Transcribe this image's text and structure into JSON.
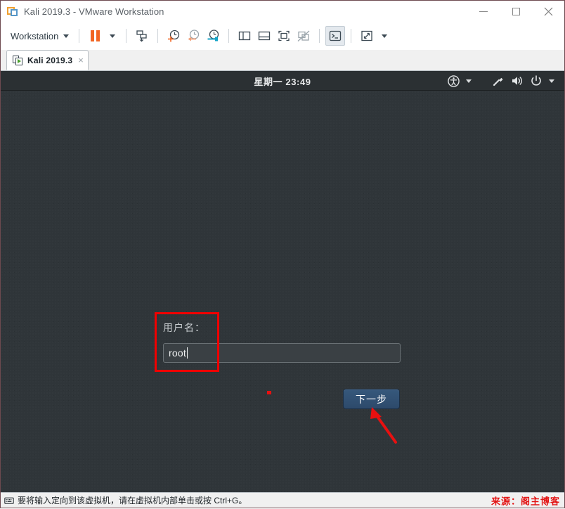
{
  "window": {
    "title": "Kali 2019.3 - VMware Workstation",
    "app_icon": "vmware-logo-icon",
    "controls": {
      "minimize": "minimize-icon",
      "maximize": "maximize-icon",
      "close": "close-icon"
    }
  },
  "toolbar": {
    "menu_label": "Workstation",
    "items": [
      {
        "name": "pause-vm",
        "icon": "pause-icon"
      },
      {
        "name": "pause-dropdown",
        "icon": "chevron-down-icon"
      },
      {
        "name": "send-ctrl-alt-del",
        "icon": "send-key-icon"
      },
      {
        "name": "take-snapshot",
        "icon": "snapshot-add-clock-icon"
      },
      {
        "name": "revert-snapshot",
        "icon": "snapshot-revert-clock-icon"
      },
      {
        "name": "manage-snapshots",
        "icon": "snapshot-manager-clock-icon"
      },
      {
        "name": "show-sidebar",
        "icon": "panel-left-icon"
      },
      {
        "name": "show-thumbnail-bar",
        "icon": "panel-bottom-icon"
      },
      {
        "name": "fullscreen",
        "icon": "fullscreen-icon"
      },
      {
        "name": "unity-mode",
        "icon": "unity-mode-disabled-icon"
      },
      {
        "name": "console-view",
        "icon": "console-prompt-icon"
      },
      {
        "name": "stretch-view",
        "icon": "expand-arrows-icon"
      },
      {
        "name": "stretch-dropdown",
        "icon": "chevron-down-icon"
      }
    ]
  },
  "tabs": [
    {
      "label": "Kali 2019.3",
      "icon": "vm-running-icon",
      "close": "×",
      "active": true
    }
  ],
  "guest": {
    "topbar": {
      "clock": "星期一 23:49",
      "status_icons": [
        {
          "name": "accessibility-icon",
          "glyph": "accessibility"
        },
        {
          "name": "accessibility-dropdown-icon",
          "glyph": "chevron-down"
        },
        {
          "name": "screwdriver-icon",
          "glyph": "screwdriver"
        },
        {
          "name": "volume-icon",
          "glyph": "speaker"
        },
        {
          "name": "power-icon",
          "glyph": "power"
        },
        {
          "name": "system-menu-dropdown-icon",
          "glyph": "chevron-down"
        }
      ]
    },
    "login": {
      "username_label": "用户名：",
      "username_value": "root",
      "username_placeholder": "",
      "next_button_label": "下一步"
    },
    "background_color": "#2f3539"
  },
  "annotations": {
    "box_color": "#f00000",
    "arrow_color": "#e81010",
    "dot_color": "#e81010"
  },
  "statusbar": {
    "message": "要将输入定向到该虚拟机，请在虚拟机内部单击或按 Ctrl+G。",
    "icon": "keyboard-icon",
    "watermark": "来源：阁主博客"
  }
}
